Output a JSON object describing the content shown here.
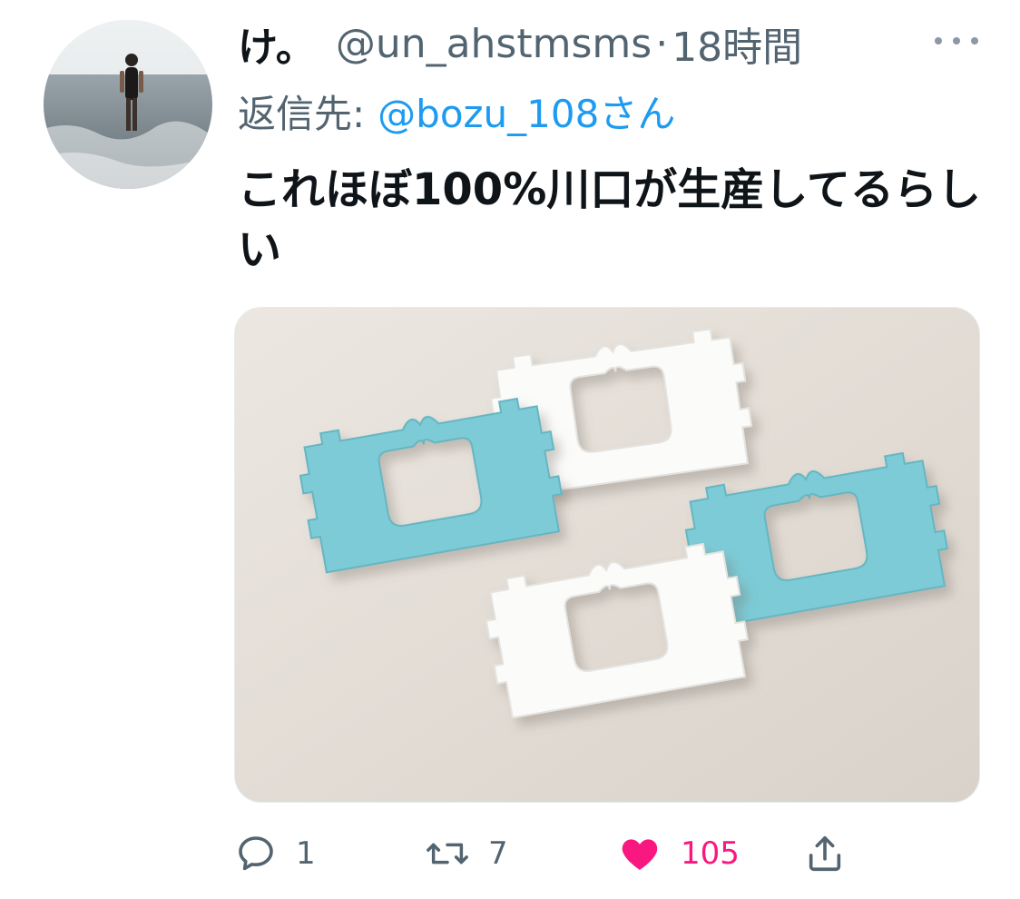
{
  "tweet": {
    "display_name": "け。",
    "handle": "@un_ahstmsms",
    "separator": "·",
    "timestamp": "18時間",
    "reply_prefix": "返信先:",
    "reply_to": "@bozu_108さん",
    "text": "これほぼ100%川口が生産してるらしい",
    "more_icon": "more-horizontal-icon",
    "media_description_icon": "photo"
  },
  "actions": {
    "reply": {
      "icon": "reply-bubble-icon",
      "count": "1"
    },
    "retweet": {
      "icon": "retweet-icon",
      "count": "7"
    },
    "like": {
      "icon": "heart-filled-icon",
      "count": "105",
      "color": "#f91880"
    },
    "share": {
      "icon": "share-upload-icon"
    }
  },
  "colors": {
    "primary_text": "#0f1419",
    "secondary_text": "#536471",
    "link": "#1d9bf0",
    "like_active": "#f91880"
  }
}
